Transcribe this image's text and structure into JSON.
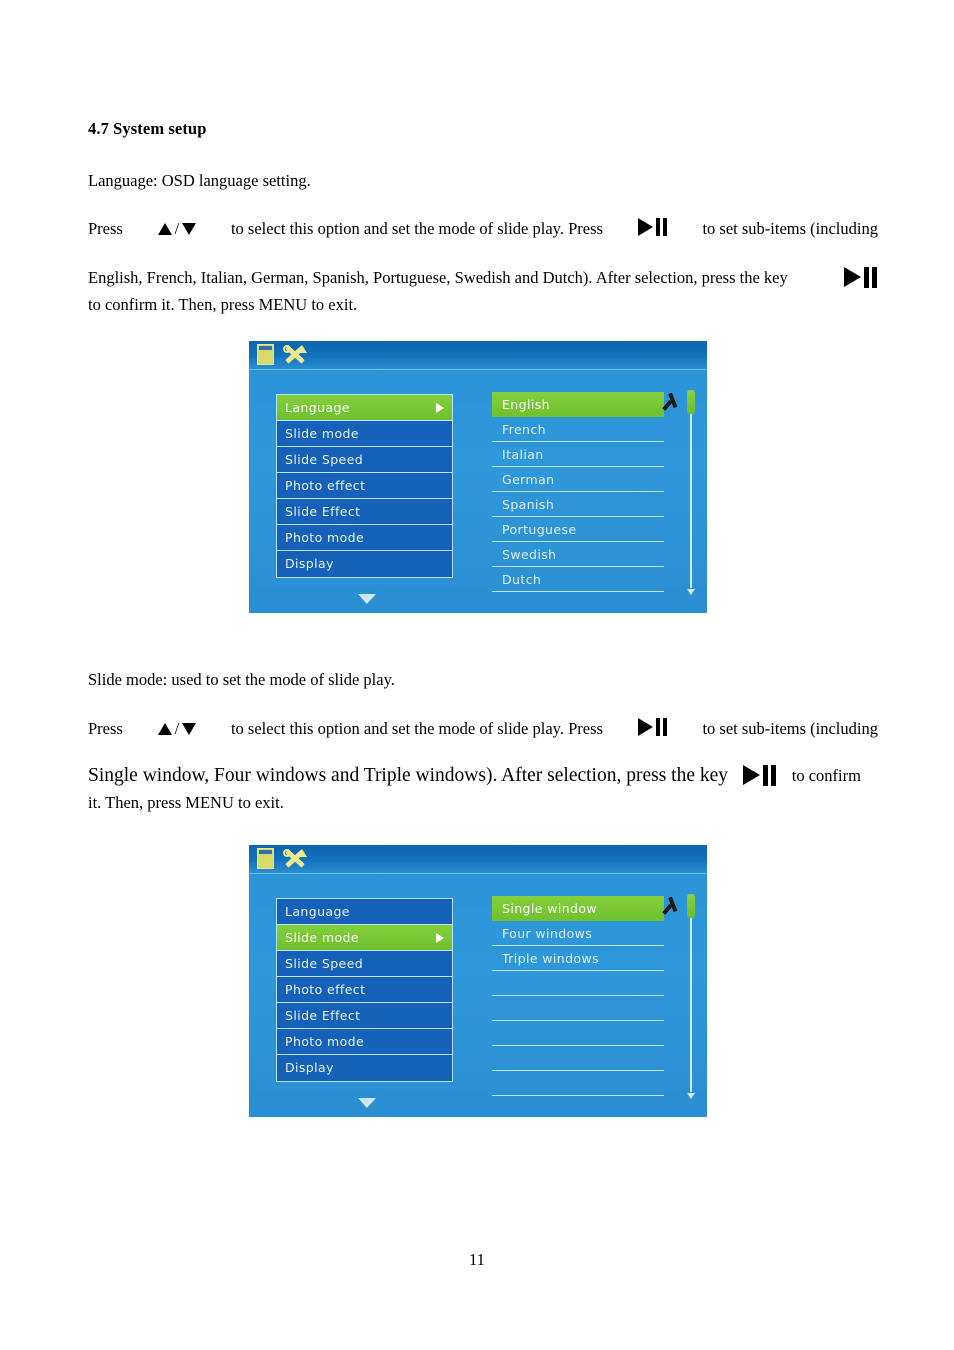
{
  "document": {
    "section_heading": "4.7 System setup",
    "page_number": "11"
  },
  "language_section": {
    "intro": "Language: OSD language setting.",
    "line1_a": "Press",
    "line1_b": "to select this option and set the mode of slide play. Press",
    "line1_c": "to set sub-items (including",
    "line2_a": "English, French, Italian, German, Spanish, Portuguese, Swedish and Dutch). After selection, press the key",
    "line3": "to confirm it. Then, press MENU to exit."
  },
  "slide_section": {
    "intro": "Slide mode: used to set the mode of slide play.",
    "line1_a": "Press",
    "line1_b": "to select this option and set the mode of slide play. Press",
    "line1_c": "to set sub-items (including",
    "line2_a": "Single window, Four windows and Triple windows). After selection, press the key",
    "line2_b": "to confirm",
    "line3": "it. Then, press MENU to exit."
  },
  "osd_language": {
    "icons": [
      "file-icon",
      "tools-icon"
    ],
    "menu_items": [
      {
        "label": "Language",
        "selected": true
      },
      {
        "label": "Slide mode",
        "selected": false
      },
      {
        "label": "Slide Speed",
        "selected": false
      },
      {
        "label": "Photo effect",
        "selected": false
      },
      {
        "label": "Slide Effect",
        "selected": false
      },
      {
        "label": "Photo mode",
        "selected": false
      },
      {
        "label": "Display",
        "selected": false
      }
    ],
    "options": [
      {
        "label": "English",
        "selected": true
      },
      {
        "label": "French",
        "selected": false
      },
      {
        "label": "Italian",
        "selected": false
      },
      {
        "label": "German",
        "selected": false
      },
      {
        "label": "Spanish",
        "selected": false
      },
      {
        "label": "Portuguese",
        "selected": false
      },
      {
        "label": "Swedish",
        "selected": false
      },
      {
        "label": "Dutch",
        "selected": false
      }
    ]
  },
  "osd_slide_mode": {
    "icons": [
      "file-icon",
      "tools-icon"
    ],
    "menu_items": [
      {
        "label": "Language",
        "selected": false
      },
      {
        "label": "Slide mode",
        "selected": true
      },
      {
        "label": "Slide Speed",
        "selected": false
      },
      {
        "label": "Photo effect",
        "selected": false
      },
      {
        "label": "Slide Effect",
        "selected": false
      },
      {
        "label": "Photo mode",
        "selected": false
      },
      {
        "label": "Display",
        "selected": false
      }
    ],
    "options": [
      {
        "label": "Single window",
        "selected": true
      },
      {
        "label": "Four windows",
        "selected": false
      },
      {
        "label": "Triple windows",
        "selected": false
      },
      {
        "label": "",
        "selected": false
      },
      {
        "label": "",
        "selected": false
      },
      {
        "label": "",
        "selected": false
      },
      {
        "label": "",
        "selected": false
      },
      {
        "label": "",
        "selected": false
      }
    ]
  },
  "colors": {
    "osd_background": "#2f98da",
    "osd_header": "#1273bd",
    "selection_green": "#76c832",
    "menu_item_blue": "#1560b8",
    "icon_yellow": "#e8e88c",
    "separator": "#bfe5f7"
  }
}
